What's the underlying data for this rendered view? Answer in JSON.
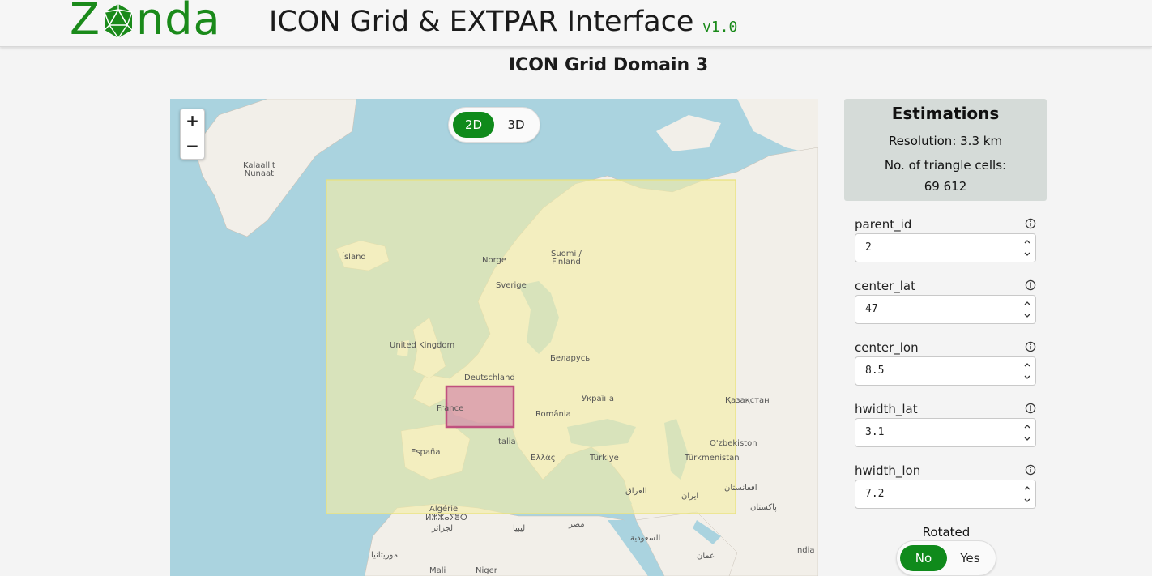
{
  "header": {
    "logo_text_left": "Z",
    "logo_text_right": "nda",
    "app_title": "ICON Grid & EXTPAR Interface",
    "version": "v1.0"
  },
  "page_title": "ICON Grid Domain 3",
  "map": {
    "zoom_in": "+",
    "zoom_out": "−",
    "view_toggle": {
      "options": [
        "2D",
        "3D"
      ],
      "selected": "2D"
    },
    "labels": {
      "greenland": "Kalaallit\nNunaat",
      "iceland": "Ísland",
      "norway": "Norge",
      "finland": "Suomi /\nFinland",
      "sweden": "Sverige",
      "uk": "United Kingdom",
      "belarus": "Беларусь",
      "germany": "Deutschland",
      "ukraine": "Україна",
      "kazakhstan": "Қазақстан",
      "france": "France",
      "romania": "România",
      "italy": "Italia",
      "uzbekistan": "O'zbekiston",
      "spain": "España",
      "greece": "Ελλάς",
      "turkey": "Türkiye",
      "turkmenistan": "Türkmenistan",
      "iraq": "العراق",
      "iran": "ایران",
      "afghanistan": "افغانستان",
      "pakistan": "پاکستان",
      "algeria": "Algérie",
      "algeria_tifinagh": "ⵍⵣⵣⴰⵢⴻⵔ",
      "algeria_ar": "الجزائر",
      "libya": "ليبيا",
      "egypt": "مصر",
      "saudi": "السعودية",
      "oman": "عمان",
      "mauritania": "موريتانيا",
      "mali": "Mali",
      "niger": "Niger",
      "india": "India"
    },
    "colors": {
      "ocean": "#aad3df",
      "land": "#f2efe9",
      "parent_domain_fill": "#f3eda4",
      "child_domain_fill": "#d48aa8",
      "child_domain_stroke": "#c0507f"
    }
  },
  "estimations": {
    "title": "Estimations",
    "resolution": "Resolution: 3.3 km",
    "cells_label": "No. of triangle cells:",
    "cells_value": "69 612"
  },
  "fields": [
    {
      "label": "parent_id",
      "value": "2"
    },
    {
      "label": "center_lat",
      "value": "47"
    },
    {
      "label": "center_lon",
      "value": "8.5"
    },
    {
      "label": "hwidth_lat",
      "value": "3.1"
    },
    {
      "label": "hwidth_lon",
      "value": "7.2"
    }
  ],
  "rotated": {
    "label": "Rotated",
    "options": [
      "No",
      "Yes"
    ],
    "selected": "No"
  },
  "brand_color": "#1a8a1a"
}
